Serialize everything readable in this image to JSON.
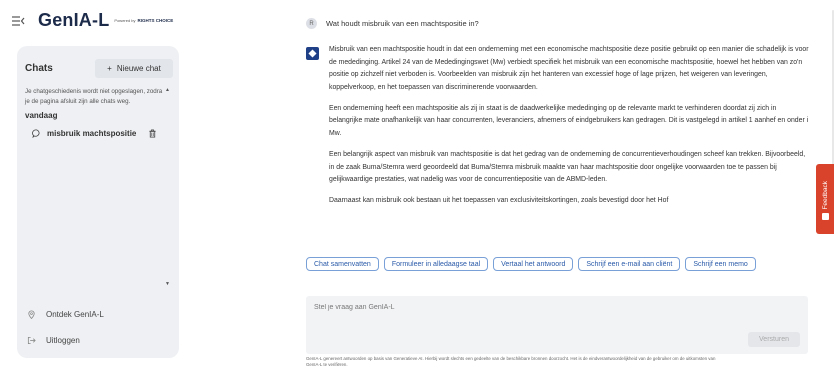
{
  "app": {
    "logo_text": "GenIA-L",
    "powered_by": "Powered by",
    "powered_brand": "RIGHTS CHOICE"
  },
  "sidebar": {
    "chats_title": "Chats",
    "new_chat_label": "Nieuwe chat",
    "notice": "Je chatgeschiedenis wordt niet opgeslagen, zodra je de pagina afsluit zijn alle chats weg.",
    "group_label": "vandaag",
    "chat_items": [
      {
        "label": "misbruik machtspositie"
      }
    ],
    "discover_label": "Ontdek GenIA-L",
    "logout_label": "Uitloggen"
  },
  "conversation": {
    "user_avatar": "R",
    "user_question": "Wat houdt misbruik van een machtspositie in?",
    "answer_paragraphs": [
      "Misbruik van een machtspositie houdt in dat een onderneming met een economische machtspositie deze positie gebruikt op een manier die schadelijk is voor de mededinging. Artikel 24 van de Mededingingswet (Mw) verbiedt specifiek het misbruik van een economische machtspositie, hoewel het hebben van zo'n positie op zichzelf niet verboden is. Voorbeelden van misbruik zijn het hanteren van excessief hoge of lage prijzen, het weigeren van leveringen, koppelverkoop, en het toepassen van discriminerende voorwaarden.",
      "Een onderneming heeft een machtspositie als zij in staat is de daadwerkelijke mededinging op de relevante markt te verhinderen doordat zij zich in belangrijke mate onafhankelijk van haar concurrenten, leveranciers, afnemers of eindgebruikers kan gedragen. Dit is vastgelegd in artikel 1 aanhef en onder i Mw.",
      "Een belangrijk aspect van misbruik van machtspositie is dat het gedrag van de onderneming de concurrentieverhoudingen scheef kan trekken. Bijvoorbeeld, in de zaak Buma/Stemra werd geoordeeld dat Buma/Stemra misbruik maakte van haar machtspositie door ongelijke voorwaarden toe te passen bij gelijkwaardige prestaties, wat nadelig was voor de concurrentiepositie van de ABMD-leden.",
      "Daarnaast kan misbruik ook bestaan uit het toepassen van exclusiviteitskortingen, zoals bevestigd door het Hof"
    ]
  },
  "suggestions": [
    "Chat samenvatten",
    "Formuleer in alledaagse taal",
    "Vertaal het antwoord",
    "Schrijf een e-mail aan cliënt",
    "Schrijf een memo"
  ],
  "input": {
    "placeholder": "Stel je vraag aan GenIA-L",
    "value": "",
    "send_label": "Versturen"
  },
  "disclaimer": "GenIA-L genereert antwoorden op basis van Generatieve AI. Hierbij wordt slechts een gedeelte van de beschikbare bronnen doorzocht. Het is de eindverantwoordelijkheid van de gebruiker om de uitkomsten van GenIA-L te verifiëren.",
  "feedback_label": "Feedback",
  "colors": {
    "brand_navy": "#1d2b4a",
    "bot_avatar": "#1f3f86",
    "chip_border": "#7aa0d8",
    "chip_text": "#2a5aa8",
    "feedback": "#d9432c"
  }
}
